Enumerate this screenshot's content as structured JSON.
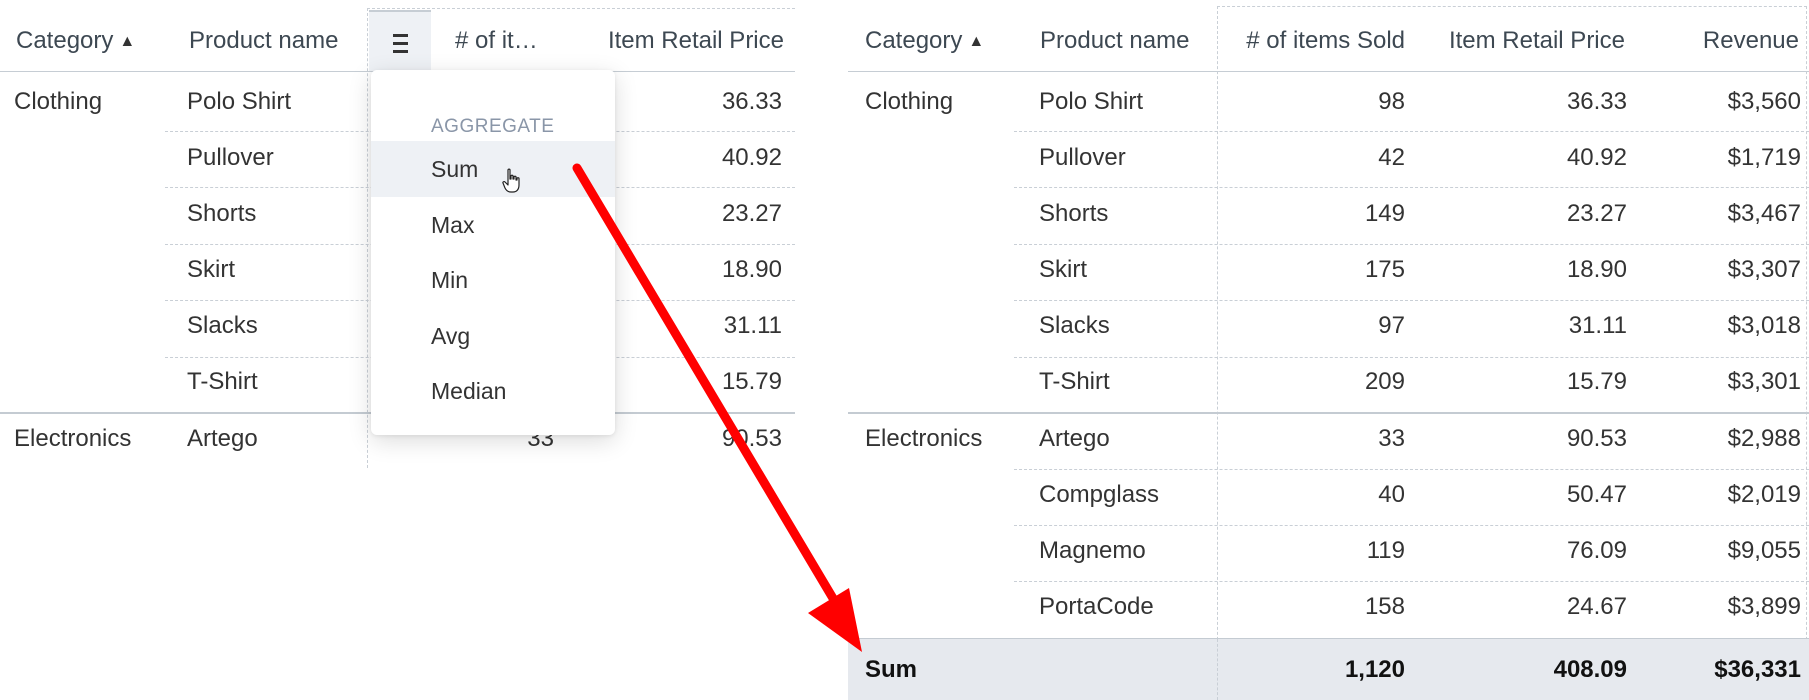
{
  "left_grid": {
    "headers": {
      "category": "Category",
      "product": "Product name",
      "items": "# of it…",
      "price": "Item Retail Price"
    },
    "rows": [
      {
        "category": "Clothing",
        "product": "Polo Shirt",
        "price": "36.33"
      },
      {
        "category": "",
        "product": "Pullover",
        "price": "40.92"
      },
      {
        "category": "",
        "product": "Shorts",
        "price": "23.27"
      },
      {
        "category": "",
        "product": "Skirt",
        "price": "18.90"
      },
      {
        "category": "",
        "product": "Slacks",
        "price": "31.11"
      },
      {
        "category": "",
        "product": "T-Shirt",
        "price": "15.79"
      },
      {
        "category": "Electronics",
        "product": "Artego",
        "items": "33",
        "price": "90.53"
      }
    ]
  },
  "menu": {
    "title": "AGGREGATE",
    "items": [
      "Sum",
      "Max",
      "Min",
      "Avg",
      "Median"
    ],
    "hovered": "Sum"
  },
  "right_grid": {
    "headers": {
      "category": "Category",
      "product": "Product name",
      "items": "# of items Sold",
      "price": "Item Retail Price",
      "revenue": "Revenue"
    },
    "rows": [
      {
        "category": "Clothing",
        "product": "Polo Shirt",
        "items": "98",
        "price": "36.33",
        "revenue": "$3,560"
      },
      {
        "category": "",
        "product": "Pullover",
        "items": "42",
        "price": "40.92",
        "revenue": "$1,719"
      },
      {
        "category": "",
        "product": "Shorts",
        "items": "149",
        "price": "23.27",
        "revenue": "$3,467"
      },
      {
        "category": "",
        "product": "Skirt",
        "items": "175",
        "price": "18.90",
        "revenue": "$3,307"
      },
      {
        "category": "",
        "product": "Slacks",
        "items": "97",
        "price": "31.11",
        "revenue": "$3,018"
      },
      {
        "category": "",
        "product": "T-Shirt",
        "items": "209",
        "price": "15.79",
        "revenue": "$3,301"
      },
      {
        "category": "Electronics",
        "product": "Artego",
        "items": "33",
        "price": "90.53",
        "revenue": "$2,988"
      },
      {
        "category": "",
        "product": "Compglass",
        "items": "40",
        "price": "50.47",
        "revenue": "$2,019"
      },
      {
        "category": "",
        "product": "Magnemo",
        "items": "119",
        "price": "76.09",
        "revenue": "$9,055"
      },
      {
        "category": "",
        "product": "PortaCode",
        "items": "158",
        "price": "24.67",
        "revenue": "$3,899"
      }
    ],
    "summary": {
      "label": "Sum",
      "items": "1,120",
      "price": "408.09",
      "revenue": "$36,331"
    }
  },
  "colors": {
    "arrow": "#ff0000",
    "summary_bg": "#e6e9ee",
    "menu_hover": "#eef1f5",
    "aggregate_title": "#8a96a8"
  }
}
